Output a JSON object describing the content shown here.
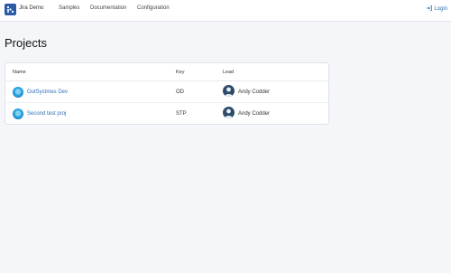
{
  "header": {
    "brand": "Jira Demo",
    "nav": [
      "Samples",
      "Documentation",
      "Configuration"
    ],
    "login_label": "Login"
  },
  "page": {
    "title": "Projects"
  },
  "table": {
    "columns": [
      "Name",
      "Key",
      "Lead"
    ],
    "rows": [
      {
        "name": "OutSystmes Dev",
        "key": "OD",
        "lead": "Andy Codder"
      },
      {
        "name": "Second test proj",
        "key": "STP",
        "lead": "Andy Codder"
      }
    ]
  },
  "icons": {
    "logo": "jira-logo-icon",
    "login": "sign-in-icon",
    "project": "project-avatar-icon",
    "lead": "user-avatar-icon"
  },
  "colors": {
    "link": "#2f6fb5",
    "brand": "#2b5aa8",
    "background": "#f4f6f9"
  }
}
